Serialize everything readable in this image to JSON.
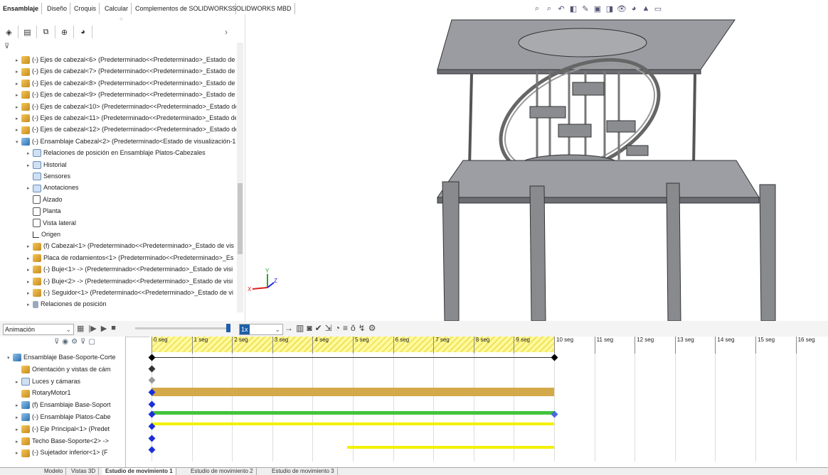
{
  "command_tabs": [
    "Ensamblaje",
    "Diseño",
    "Croquis",
    "Calcular",
    "Complementos de SOLIDWORKS",
    "SOLIDWORKS MBD"
  ],
  "feature_tree": [
    {
      "label": "(-) Ejes de cabezal<6> (Predeterminado<<Predeterminado>_Estado de",
      "icon": "part-icon",
      "expand": "▸"
    },
    {
      "label": "(-) Ejes de cabezal<7> (Predeterminado<<Predeterminado>_Estado de",
      "icon": "part-icon",
      "expand": "▸"
    },
    {
      "label": "(-) Ejes de cabezal<8> (Predeterminado<<Predeterminado>_Estado de",
      "icon": "part-icon",
      "expand": "▸"
    },
    {
      "label": "(-) Ejes de cabezal<9> (Predeterminado<<Predeterminado>_Estado de",
      "icon": "part-icon",
      "expand": "▸"
    },
    {
      "label": "(-) Ejes de cabezal<10> (Predeterminado<<Predeterminado>_Estado de",
      "icon": "part-icon",
      "expand": "▸"
    },
    {
      "label": "(-) Ejes de cabezal<11> (Predeterminado<<Predeterminado>_Estado de",
      "icon": "part-icon",
      "expand": "▸"
    },
    {
      "label": "(-) Ejes de cabezal<12> (Predeterminado<<Predeterminado>_Estado de",
      "icon": "part-icon",
      "expand": "▸"
    },
    {
      "label": "(-) Ensamblaje Cabezal<2> (Predeterminado<Estado de visualización-1:",
      "icon": "asm-icon",
      "expand": "▾"
    },
    {
      "label": "Relaciones de posición en Ensamblaje Platos-Cabezales",
      "icon": "folder-icon",
      "expand": "▸"
    },
    {
      "label": "Historial",
      "icon": "folder-icon",
      "expand": "▸"
    },
    {
      "label": "Sensores",
      "icon": "folder-icon",
      "expand": ""
    },
    {
      "label": "Anotaciones",
      "icon": "folder-icon",
      "expand": "▸"
    },
    {
      "label": "Alzado",
      "icon": "plane-icon",
      "expand": ""
    },
    {
      "label": "Planta",
      "icon": "plane-icon",
      "expand": ""
    },
    {
      "label": "Vista lateral",
      "icon": "plane-icon",
      "expand": ""
    },
    {
      "label": "Origen",
      "icon": "origin-icon",
      "expand": ""
    },
    {
      "label": "(f) Cabezal<1> (Predeterminado<<Predeterminado>_Estado de vis",
      "icon": "part-icon",
      "expand": "▸"
    },
    {
      "label": "Placa de rodamientos<1> (Predeterminado<<Predeterminado>_Es",
      "icon": "part-icon",
      "expand": "▸"
    },
    {
      "label": "(-) Buje<1> -> (Predeterminado<<Predeterminado>_Estado de visi",
      "icon": "part-icon",
      "expand": "▸"
    },
    {
      "label": "(-) Buje<2> -> (Predeterminado<<Predeterminado>_Estado de visi",
      "icon": "part-icon",
      "expand": "▸"
    },
    {
      "label": "(-) Seguidor<1> (Predeterminado<<Predeterminado>_Estado de vi",
      "icon": "part-icon",
      "expand": "▸"
    },
    {
      "label": "Relaciones de posición",
      "icon": "rel-icon",
      "expand": "▸"
    }
  ],
  "motion": {
    "study_type": "Animación",
    "speed": "1x",
    "tree": [
      {
        "label": "Ensamblaje Base-Soporte-Corte",
        "expand": "▾",
        "icon": "asm-icon"
      },
      {
        "label": "Orientación y vistas de cám",
        "expand": "",
        "icon": "part-icon"
      },
      {
        "label": "Luces y cámaras",
        "expand": "▸",
        "icon": "folder-icon"
      },
      {
        "label": "RotaryMotor1",
        "expand": "",
        "icon": "part-icon"
      },
      {
        "label": "(f) Ensamblaje Base-Soport",
        "expand": "▸",
        "icon": "asm-icon"
      },
      {
        "label": "(-) Ensamblaje Platos-Cabe",
        "expand": "▸",
        "icon": "asm-icon"
      },
      {
        "label": "(-) Eje Principal<1> (Predet",
        "expand": "▸",
        "icon": "part-icon"
      },
      {
        "label": "Techo Base-Soporte<2> ->",
        "expand": "▸",
        "icon": "part-icon"
      },
      {
        "label": "(-) Sujetador inferior<1> (F",
        "expand": "▸",
        "icon": "part-icon"
      }
    ],
    "ticks": [
      "0 seg",
      "1 seg",
      "2 seg",
      "3 seg",
      "4 seg",
      "5 seg",
      "6 seg",
      "7 seg",
      "8 seg",
      "9 seg",
      "10 seg",
      "11 seg",
      "12 seg",
      "13 seg",
      "14 seg",
      "15 seg",
      "16 seg"
    ]
  },
  "bottom_tabs": [
    "Modelo",
    "Vistas 3D",
    "Estudio de movimiento 1",
    "Estudio de movimiento 2",
    "Estudio de movimiento 3"
  ],
  "colors": {
    "accent": "#1e5fa8",
    "bar_tan": "#d4a94a",
    "bar_green": "#43c33b",
    "bar_yellow": "#f3f000",
    "key_blue": "#1a2fd8"
  }
}
